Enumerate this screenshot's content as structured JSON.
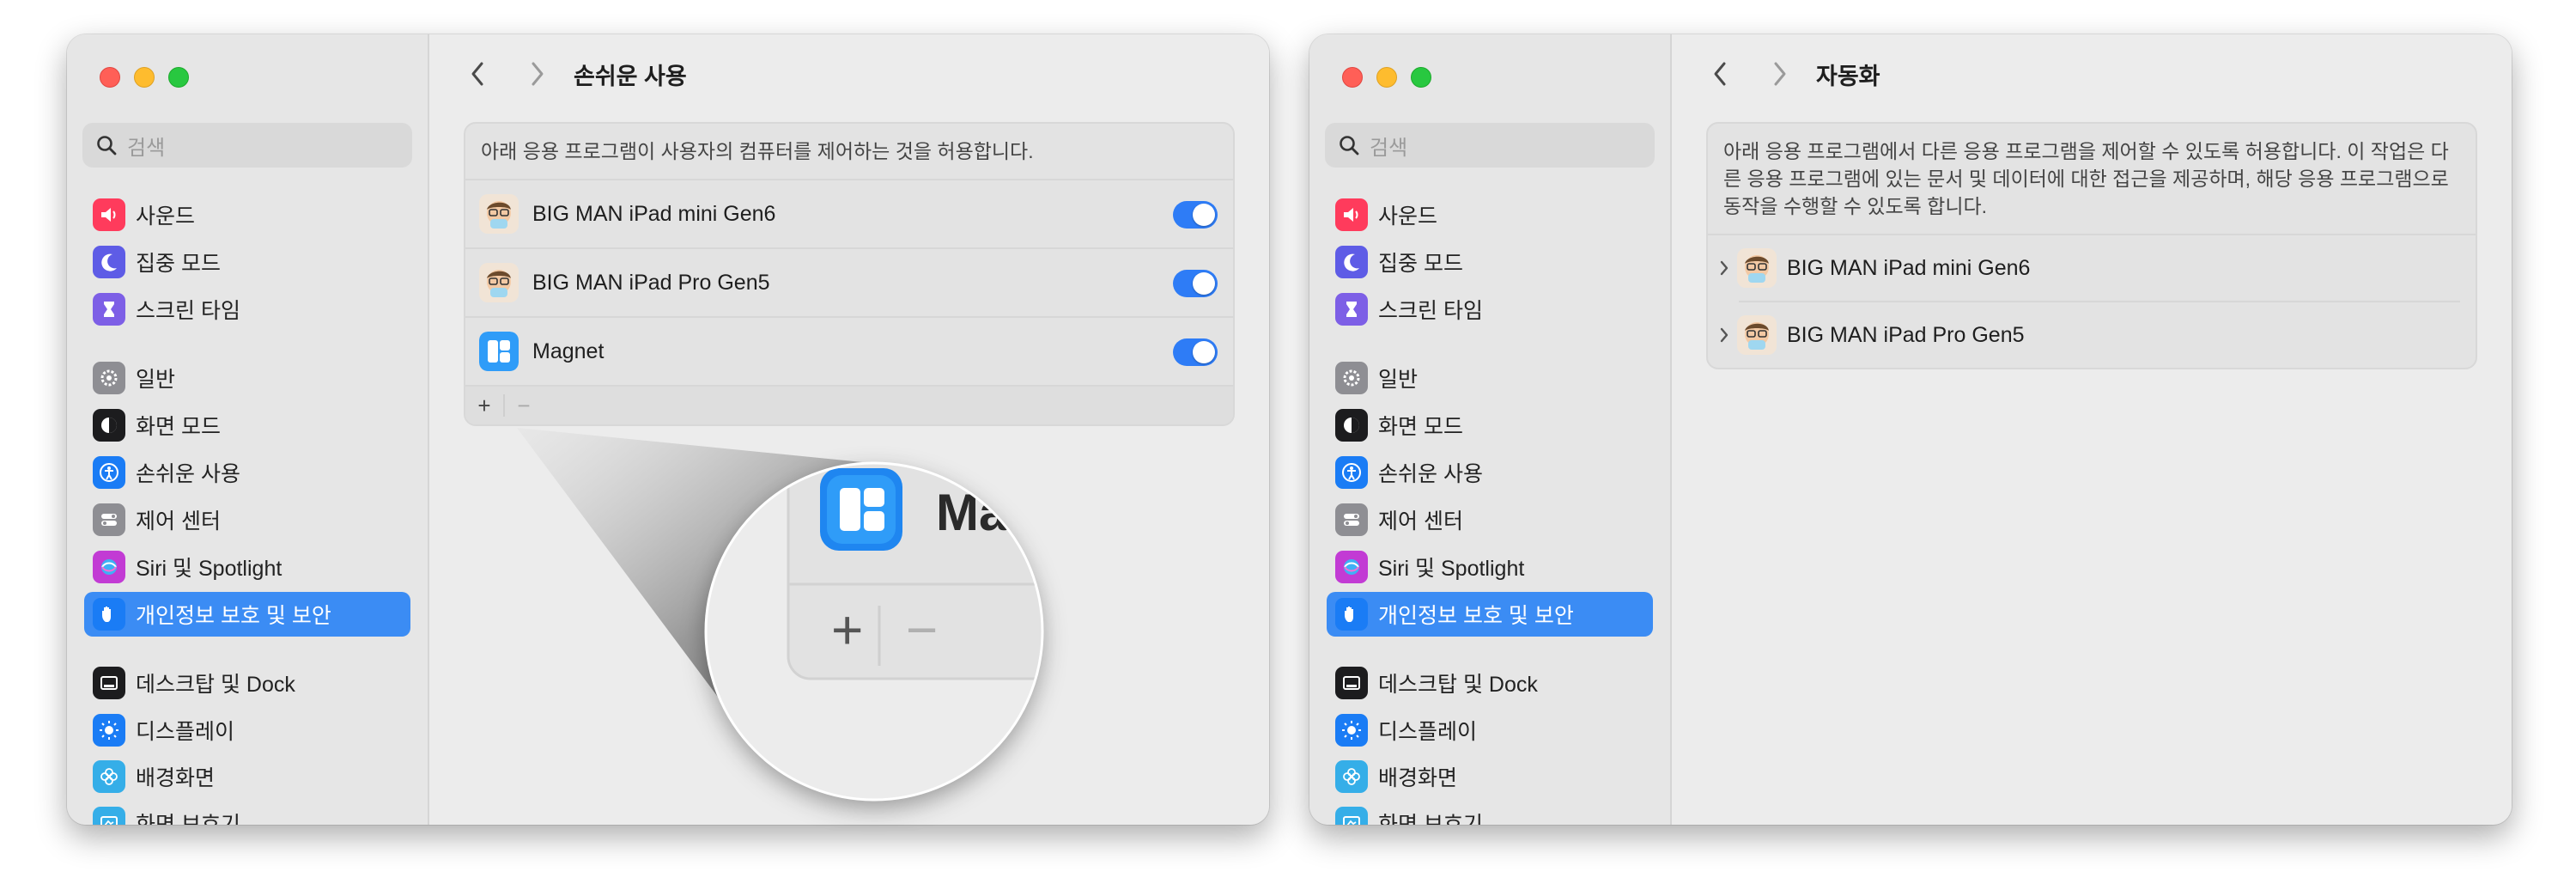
{
  "left_window": {
    "search_placeholder": "검색",
    "sidebar": {
      "items": [
        {
          "label": "사운드",
          "icon": "speaker-icon",
          "color": "#ff3b5c"
        },
        {
          "label": "집중 모드",
          "icon": "moon-icon",
          "color": "#5e5ce6"
        },
        {
          "label": "스크린 타임",
          "icon": "hourglass-icon",
          "color": "#7d5fe6"
        },
        {
          "label": "일반",
          "icon": "gear-icon",
          "color": "#8e8e93"
        },
        {
          "label": "화면 모드",
          "icon": "appearance-icon",
          "color": "#1c1c1e"
        },
        {
          "label": "손쉬운 사용",
          "icon": "accessibility-icon",
          "color": "#1a7cf5"
        },
        {
          "label": "제어 센터",
          "icon": "control-center-icon",
          "color": "#8e8e93"
        },
        {
          "label": "Siri 및 Spotlight",
          "icon": "siri-icon",
          "color": "#c23bd4"
        },
        {
          "label": "개인정보 보호 및 보안",
          "icon": "hand-icon",
          "color": "#1a7cf5"
        },
        {
          "label": "데스크탑 및 Dock",
          "icon": "dock-icon",
          "color": "#1c1c1e"
        },
        {
          "label": "디스플레이",
          "icon": "sun-icon",
          "color": "#1a7cf5"
        },
        {
          "label": "배경화면",
          "icon": "flower-icon",
          "color": "#35aee8"
        },
        {
          "label": "화면 보호기",
          "icon": "screensaver-icon",
          "color": "#35aee8"
        }
      ]
    },
    "title": "손쉬운 사용",
    "description": "아래 응용 프로그램이 사용자의 컴퓨터를 제어하는 것을 허용합니다.",
    "apps": [
      {
        "name": "BIG MAN iPad mini Gen6",
        "enabled": true
      },
      {
        "name": "BIG MAN iPad Pro Gen5",
        "enabled": true
      },
      {
        "name": "Magnet",
        "enabled": true
      }
    ],
    "add_label": "+",
    "remove_label": "−",
    "magnifier": {
      "app_name_partial": "Ma",
      "add_label": "+",
      "remove_label": "−"
    }
  },
  "right_window": {
    "search_placeholder": "검색",
    "sidebar": {
      "items": [
        {
          "label": "사운드",
          "icon": "speaker-icon",
          "color": "#ff3b5c"
        },
        {
          "label": "집중 모드",
          "icon": "moon-icon",
          "color": "#5e5ce6"
        },
        {
          "label": "스크린 타임",
          "icon": "hourglass-icon",
          "color": "#7d5fe6"
        },
        {
          "label": "일반",
          "icon": "gear-icon",
          "color": "#8e8e93"
        },
        {
          "label": "화면 모드",
          "icon": "appearance-icon",
          "color": "#1c1c1e"
        },
        {
          "label": "손쉬운 사용",
          "icon": "accessibility-icon",
          "color": "#1a7cf5"
        },
        {
          "label": "제어 센터",
          "icon": "control-center-icon",
          "color": "#8e8e93"
        },
        {
          "label": "Siri 및 Spotlight",
          "icon": "siri-icon",
          "color": "#c23bd4"
        },
        {
          "label": "개인정보 보호 및 보안",
          "icon": "hand-icon",
          "color": "#1a7cf5"
        },
        {
          "label": "데스크탑 및 Dock",
          "icon": "dock-icon",
          "color": "#1c1c1e"
        },
        {
          "label": "디스플레이",
          "icon": "sun-icon",
          "color": "#1a7cf5"
        },
        {
          "label": "배경화면",
          "icon": "flower-icon",
          "color": "#35aee8"
        },
        {
          "label": "화면 보호기",
          "icon": "screensaver-icon",
          "color": "#35aee8"
        }
      ]
    },
    "title": "자동화",
    "description": "아래 응용 프로그램에서 다른 응용 프로그램을 제어할 수 있도록 허용합니다. 이 작업은 다른 응용 프로그램에 있는 문서 및 데이터에 대한 접근을 제공하며, 해당 응용 프로그램으로 동작을 수행할 수 있도록 합니다.",
    "apps": [
      {
        "name": "BIG MAN iPad mini Gen6"
      },
      {
        "name": "BIG MAN iPad Pro Gen5"
      }
    ]
  },
  "colors": {
    "accent": "#3b8cf4",
    "toggle_on": "#2e7cf6",
    "traffic_red": "#ff5f57",
    "traffic_yellow": "#febc2e",
    "traffic_green": "#28c840"
  }
}
